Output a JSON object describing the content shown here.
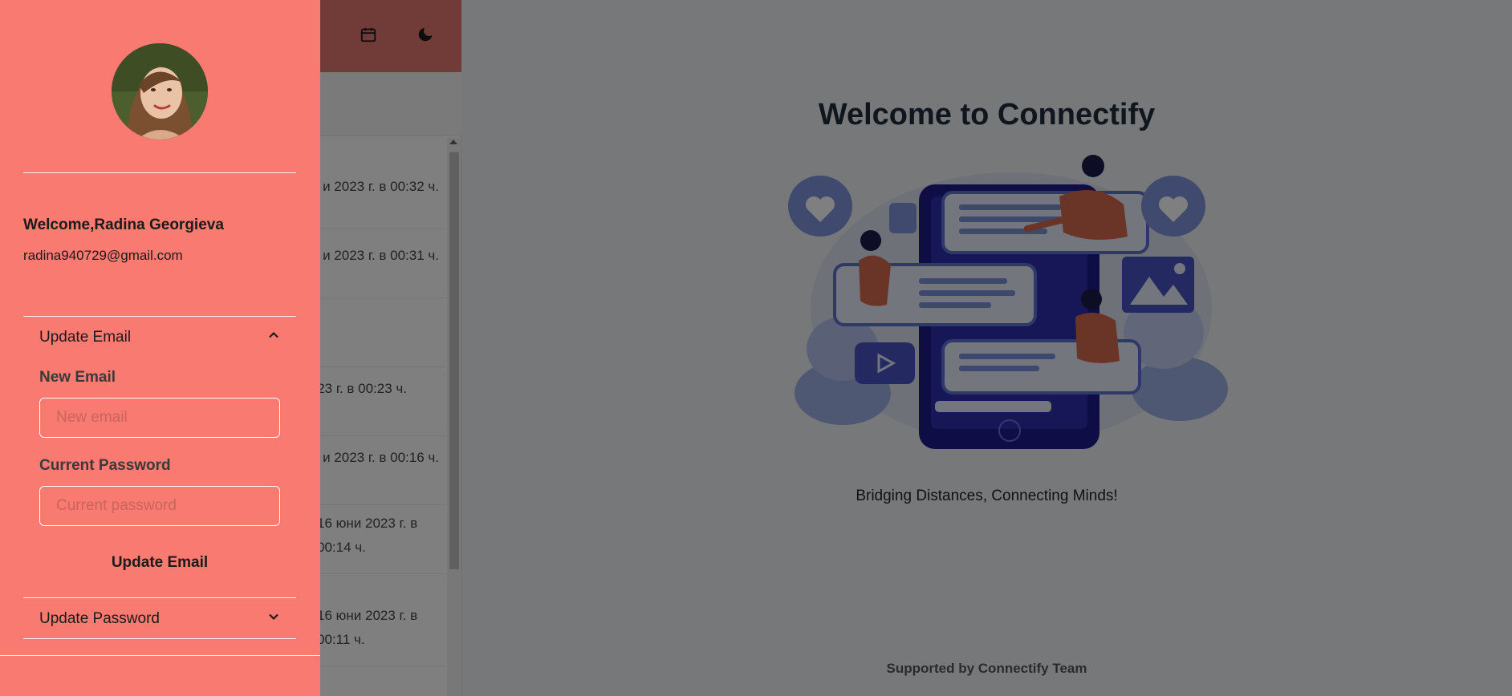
{
  "app": {
    "title": "Welcome to Connectify",
    "tagline": "Bridging Distances, Connecting Minds!",
    "footer": "Supported by Connectify Team",
    "header_icons": [
      "calendar-icon",
      "moon-icon"
    ]
  },
  "chats": [
    {
      "time_line1": "и 2023 г. в 00:32 ч.",
      "time_line2": ""
    },
    {
      "time_line1": "и 2023 г. в 00:31 ч.",
      "time_line2": ""
    },
    {
      "time_line1": ".",
      "time_line2": ""
    },
    {
      "time_line1": "023 г. в 00:23 ч.",
      "time_line2": ""
    },
    {
      "time_line1": "и 2023 г. в 00:16 ч.",
      "time_line2": ""
    },
    {
      "time_line1": "16 юни 2023 г. в",
      "time_line2": "00:14 ч."
    },
    {
      "time_line1": "16 юни 2023 г. в",
      "time_line2": "00:11 ч."
    }
  ],
  "drawer": {
    "welcome": "Welcome,Radina Georgieva",
    "email": "radina940729@gmail.com",
    "update_email": {
      "header": "Update Email",
      "new_email_label": "New Email",
      "new_email_placeholder": "New email",
      "new_email_value": "",
      "current_password_label": "Current Password",
      "current_password_placeholder": "Current password",
      "current_password_value": "",
      "submit_label": "Update Email",
      "expanded": true
    },
    "update_password": {
      "header": "Update Password",
      "expanded": false
    }
  },
  "colors": {
    "drawer_bg": "#f87a70",
    "header_bg": "#e3766e",
    "overlay": "rgba(0,0,0,0.5)"
  }
}
